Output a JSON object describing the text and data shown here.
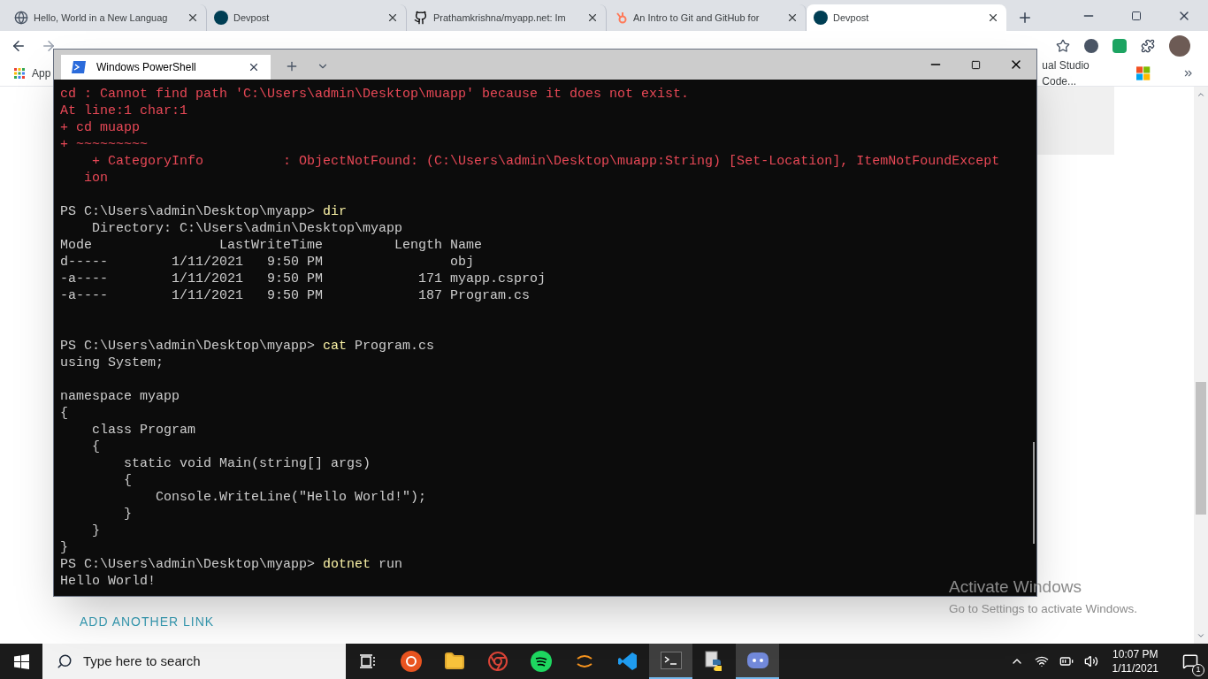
{
  "browser": {
    "tabs": [
      {
        "title": "Hello, World in a New Languag",
        "selected": false
      },
      {
        "title": "Devpost",
        "selected": false
      },
      {
        "title": "Prathamkrishna/myapp.net: Im",
        "selected": false
      },
      {
        "title": "An Intro to Git and GitHub for",
        "selected": false
      },
      {
        "title": "Devpost",
        "selected": true
      }
    ],
    "bookmarks": [
      {
        "label": "App",
        "kind": "apps"
      },
      {
        "label": "ual Studio Code...",
        "kind": "link"
      }
    ],
    "page": {
      "link": "ADD ANOTHER LINK"
    }
  },
  "terminal": {
    "tab_title": "Windows PowerShell",
    "lines": [
      {
        "kind": "error",
        "text": "cd : Cannot find path 'C:\\Users\\admin\\Desktop\\muapp' because it does not exist."
      },
      {
        "kind": "error",
        "text": "At line:1 char:1"
      },
      {
        "kind": "error",
        "text": "+ cd muapp"
      },
      {
        "kind": "error",
        "text": "+ ~~~~~~~~~"
      },
      {
        "kind": "error",
        "text": "    + CategoryInfo          : ObjectNotFound: (C:\\Users\\admin\\Desktop\\muapp:String) [Set-Location], ItemNotFoundExcept"
      },
      {
        "kind": "error",
        "text": "   ion"
      },
      {
        "kind": "blank"
      },
      {
        "kind": "prompt",
        "prompt": "PS C:\\Users\\admin\\Desktop\\myapp>",
        "command": "dir"
      },
      {
        "kind": "output",
        "text": "    Directory: C:\\Users\\admin\\Desktop\\myapp"
      },
      {
        "kind": "output",
        "text": "Mode                LastWriteTime         Length Name"
      },
      {
        "kind": "output",
        "text": "d-----        1/11/2021   9:50 PM                obj"
      },
      {
        "kind": "output",
        "text": "-a----        1/11/2021   9:50 PM            171 myapp.csproj"
      },
      {
        "kind": "output",
        "text": "-a----        1/11/2021   9:50 PM            187 Program.cs"
      },
      {
        "kind": "blank"
      },
      {
        "kind": "blank"
      },
      {
        "kind": "prompt",
        "prompt": "PS C:\\Users\\admin\\Desktop\\myapp>",
        "command": "cat",
        "args": "Program.cs"
      },
      {
        "kind": "output",
        "text": "using System;"
      },
      {
        "kind": "blank"
      },
      {
        "kind": "output",
        "text": "namespace myapp"
      },
      {
        "kind": "output",
        "text": "{"
      },
      {
        "kind": "output",
        "text": "    class Program"
      },
      {
        "kind": "output",
        "text": "    {"
      },
      {
        "kind": "output",
        "text": "        static void Main(string[] args)"
      },
      {
        "kind": "output",
        "text": "        {"
      },
      {
        "kind": "output",
        "text": "            Console.WriteLine(\"Hello World!\");"
      },
      {
        "kind": "output",
        "text": "        }"
      },
      {
        "kind": "output",
        "text": "    }"
      },
      {
        "kind": "output",
        "text": "}"
      },
      {
        "kind": "prompt",
        "prompt": "PS C:\\Users\\admin\\Desktop\\myapp>",
        "command": "dotnet",
        "args": "run"
      },
      {
        "kind": "output",
        "text": "Hello World!"
      }
    ]
  },
  "activation": {
    "title": "Activate Windows",
    "subtitle": "Go to Settings to activate Windows."
  },
  "taskbar": {
    "search": {
      "placeholder": "Type here to search"
    },
    "apps": [
      {
        "selected": false
      },
      {
        "selected": false
      },
      {
        "selected": false
      },
      {
        "selected": false
      },
      {
        "selected": false
      },
      {
        "selected": false
      },
      {
        "selected": false
      },
      {
        "selected": true
      },
      {
        "selected": false
      },
      {
        "selected": true
      }
    ],
    "time": "10:07 PM",
    "date": "1/11/2021",
    "notifications": "1"
  }
}
